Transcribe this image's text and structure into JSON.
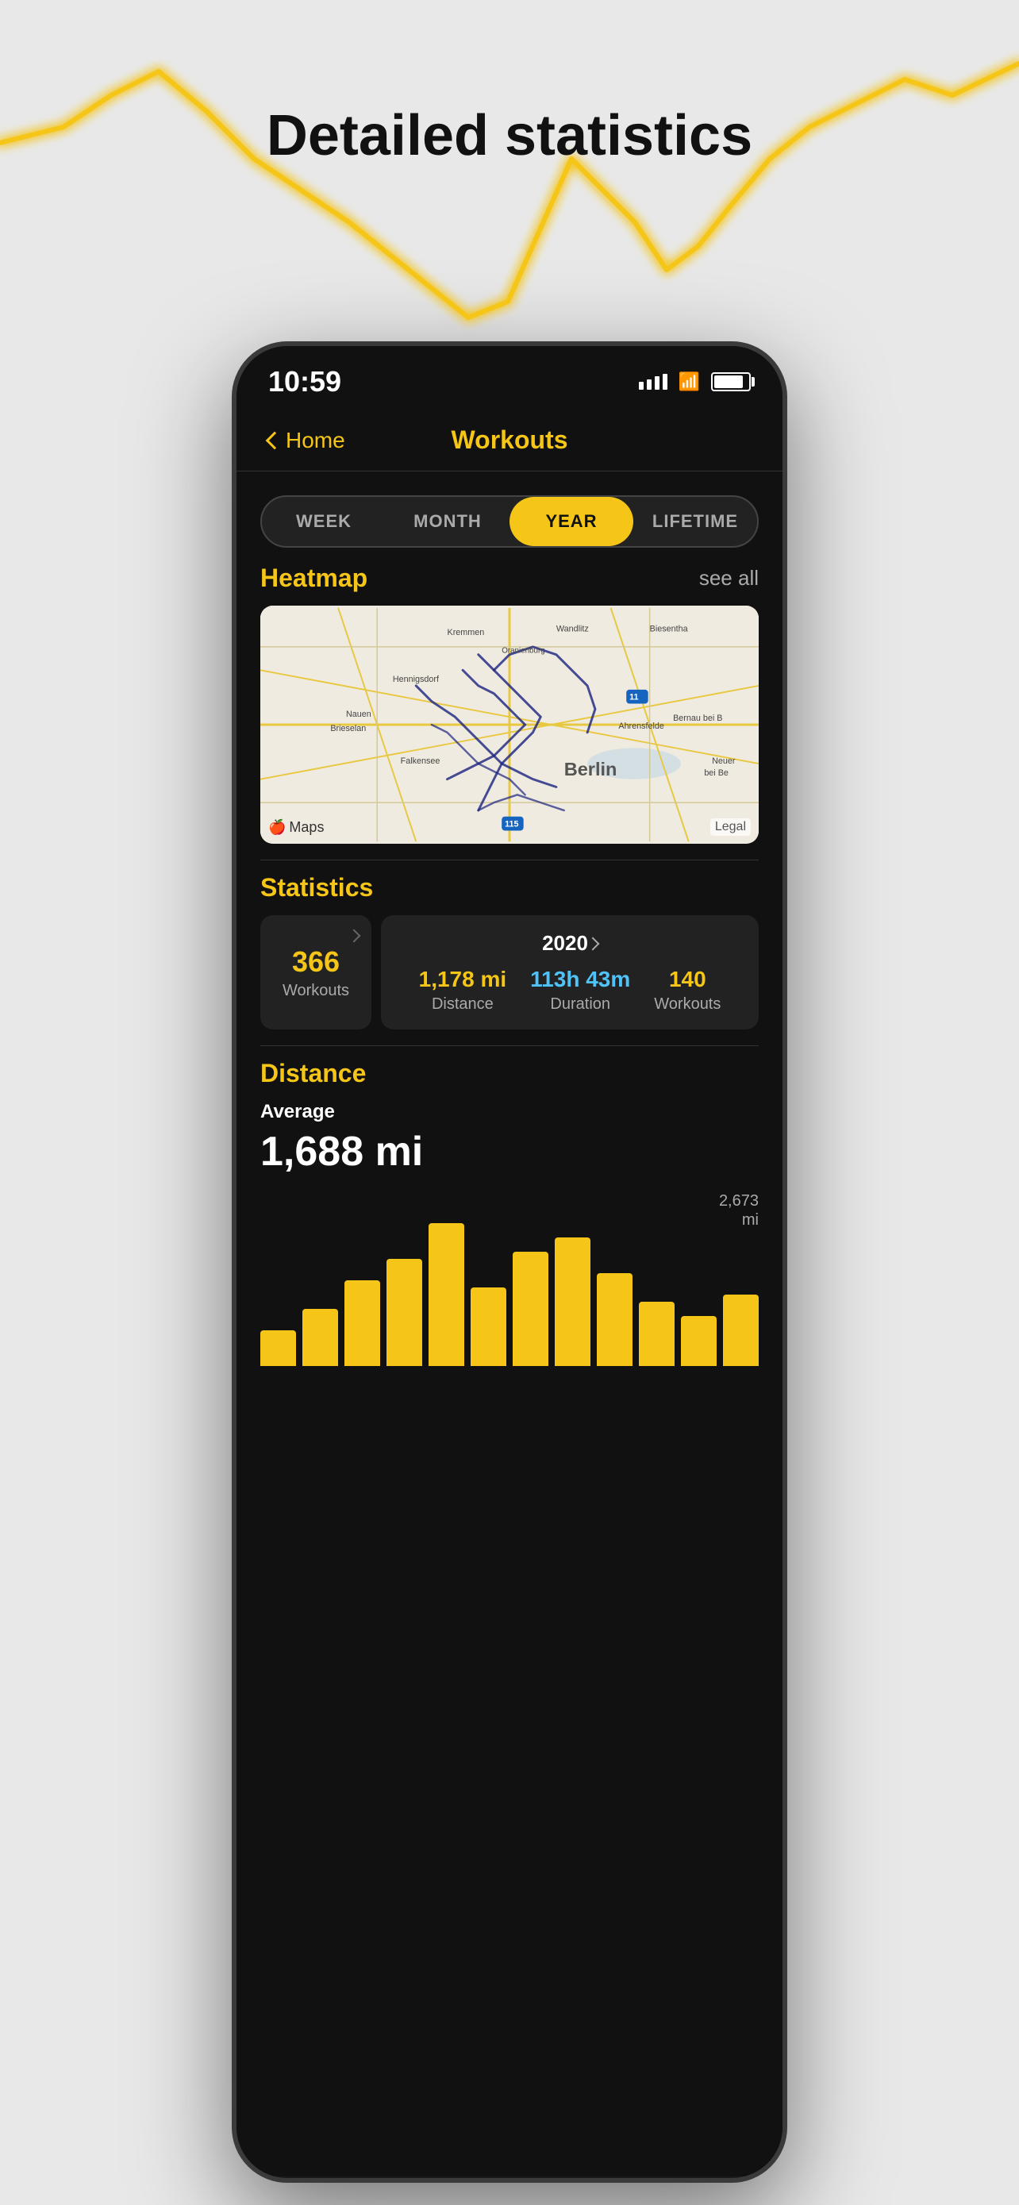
{
  "background": {
    "title": "Detailed statistics"
  },
  "status_bar": {
    "time": "10:59"
  },
  "nav": {
    "back_label": "Home",
    "title": "Workouts"
  },
  "tabs": [
    {
      "label": "WEEK",
      "active": false
    },
    {
      "label": "MONTH",
      "active": false
    },
    {
      "label": "YEAR",
      "active": true
    },
    {
      "label": "LIFETIME",
      "active": false
    }
  ],
  "heatmap": {
    "section_title": "Heatmap",
    "see_all": "see all"
  },
  "statistics": {
    "section_title": "Statistics",
    "left_card": {
      "value": "366",
      "label": "Workouts"
    },
    "right_card": {
      "year": "2020",
      "items": [
        {
          "value": "1,178 mi",
          "label": "Distance",
          "color": "yellow"
        },
        {
          "value": "113h 43m",
          "label": "Duration",
          "color": "cyan"
        },
        {
          "value": "140",
          "label": "Workouts",
          "color": "yellow"
        }
      ]
    }
  },
  "distance": {
    "section_title": "Distance",
    "avg_label": "Average",
    "avg_value": "1,688 mi",
    "max_label": "2,673\nmi",
    "bars": [
      25,
      40,
      60,
      75,
      100,
      55,
      80,
      90,
      65,
      45,
      35,
      50
    ]
  }
}
